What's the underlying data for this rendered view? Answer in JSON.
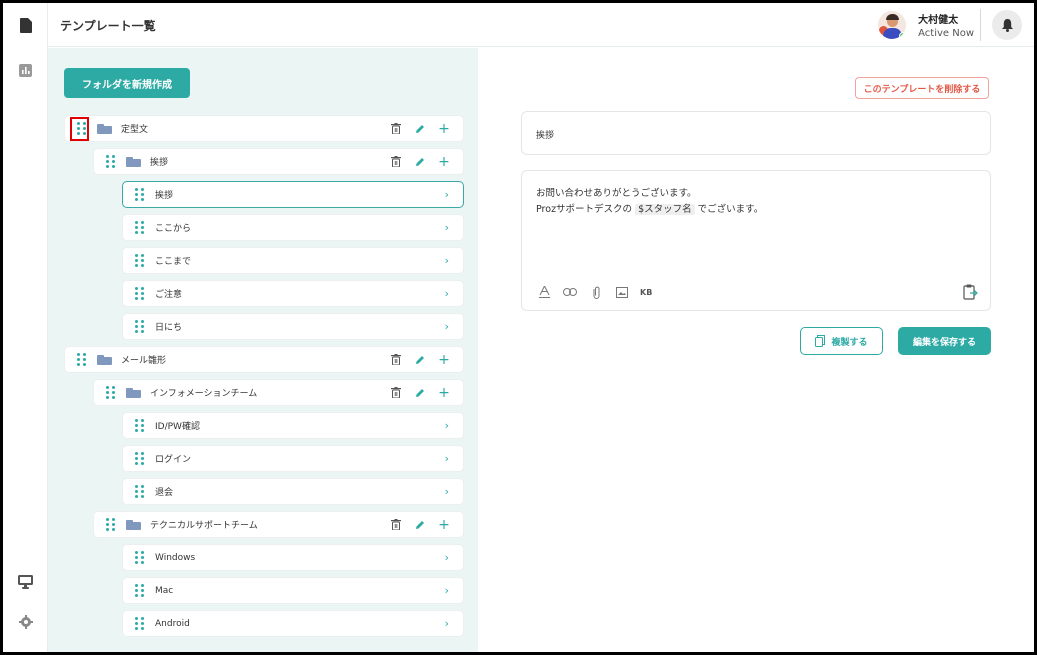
{
  "header": {
    "title": "テンプレート一覧",
    "user_name": "大村健太",
    "user_status": "Active Now"
  },
  "tree": {
    "new_folder_label": "フォルダを新規作成",
    "rows": [
      {
        "label": "定型文",
        "kind": "folder"
      },
      {
        "label": "挨拶",
        "kind": "folder"
      },
      {
        "label": "挨拶",
        "kind": "template",
        "selected": true
      },
      {
        "label": "ここから",
        "kind": "template"
      },
      {
        "label": "ここまで",
        "kind": "template"
      },
      {
        "label": "ご注意",
        "kind": "template"
      },
      {
        "label": "日にち",
        "kind": "template"
      },
      {
        "label": "メール雛形",
        "kind": "folder"
      },
      {
        "label": "インフォメーションチーム",
        "kind": "folder"
      },
      {
        "label": "ID/PW確認",
        "kind": "template"
      },
      {
        "label": "ログイン",
        "kind": "template"
      },
      {
        "label": "退会",
        "kind": "template"
      },
      {
        "label": "テクニカルサポートチーム",
        "kind": "folder"
      },
      {
        "label": "Windows",
        "kind": "template"
      },
      {
        "label": "Mac",
        "kind": "template"
      },
      {
        "label": "Android",
        "kind": "template"
      }
    ]
  },
  "editor": {
    "delete_label": "このテンプレートを削除する",
    "title_value": "挨拶",
    "body_line1": "お問い合わせありがとうございます。",
    "body_line2_prefix": "Prozサポートデスクの",
    "body_tag": "$スタッフ名",
    "body_line2_suffix": "でございます。",
    "toolbar_kb": "KB",
    "copy_label": "複製する",
    "save_label": "編集を保存する"
  },
  "colors": {
    "accent": "#2eaaa5",
    "panel_bg": "#eaf5f4",
    "danger": "#e35849",
    "folder": "#8097be"
  }
}
